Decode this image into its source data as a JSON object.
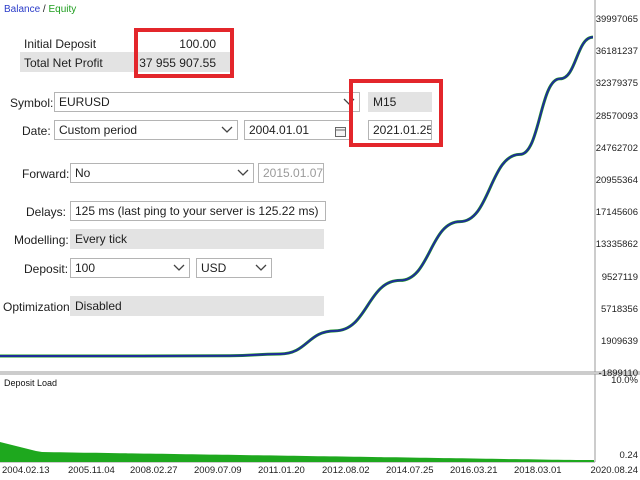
{
  "legend": {
    "balance": "Balance",
    "separator": " / ",
    "equity": "Equity"
  },
  "colors": {
    "balance": "#2b3cc9",
    "equity": "#1e9e1e",
    "highlight": "#e3262b",
    "load": "#1ea81e"
  },
  "y_axis": [
    "39997065",
    "36181237",
    "32379375",
    "28570093",
    "24762702",
    "20955364",
    "17145606",
    "13335862",
    "9527119",
    "5718356",
    "1909639",
    "-1899110"
  ],
  "load_axis": [
    "10.0%",
    "0.24"
  ],
  "x_axis": [
    "2004.02.13",
    "2005.11.04",
    "2008.02.27",
    "2009.07.09",
    "2011.01.20",
    "2012.08.02",
    "2014.07.25",
    "2016.03.21",
    "2018.03.01",
    "2020.08.24"
  ],
  "summary": {
    "initial_deposit_label": "Initial Deposit",
    "initial_deposit_value": "100.00",
    "net_profit_label": "Total Net Profit",
    "net_profit_value": "37 955 907.55"
  },
  "form": {
    "symbol_label": "Symbol:",
    "symbol_value": "EURUSD",
    "timeframe_value": "M15",
    "date_label": "Date:",
    "date_mode": "Custom period",
    "date_from": "2004.01.01",
    "date_to": "2021.01.25",
    "forward_label": "Forward:",
    "forward_value": "No",
    "forward_date": "2015.01.07",
    "delays_label": "Delays:",
    "delays_value": "125 ms (last ping to your server is 125.22 ms)",
    "modelling_label": "Modelling:",
    "modelling_value": "Every tick",
    "deposit_label": "Deposit:",
    "deposit_value": "100",
    "currency_value": "USD",
    "optimization_label": "Optimization:",
    "optimization_value": "Disabled"
  },
  "deposit_load_label": "Deposit Load",
  "chart_data": {
    "type": "line",
    "series": [
      {
        "name": "Balance",
        "values": [
          100,
          100,
          5000,
          40000,
          250000,
          3000000,
          9000000,
          16000000,
          24000000,
          33000000,
          37955907.55
        ]
      },
      {
        "name": "Equity",
        "values": [
          100,
          100,
          5000,
          40000,
          250000,
          3000000,
          9000000,
          16000000,
          24000000,
          33000000,
          37955907.55
        ]
      }
    ],
    "x": [
      "2004.02.13",
      "2005.11.04",
      "2008.02.27",
      "2009.07.09",
      "2011.01.20",
      "2012.08.02",
      "2014.07.25",
      "2016.03.21",
      "2018.03.01",
      "2019.06.01",
      "2020.08.24"
    ],
    "ylim": [
      -1899110,
      39997065
    ]
  }
}
